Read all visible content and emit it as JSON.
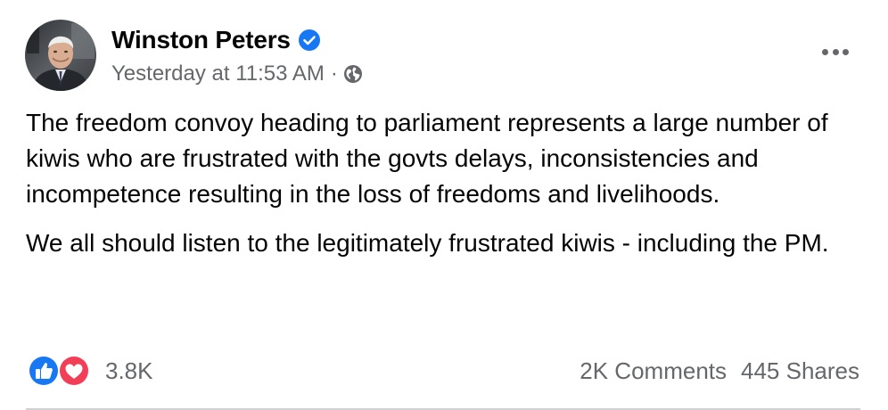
{
  "post": {
    "author": "Winston Peters",
    "timestamp": "Yesterday at 11:53 AM",
    "separator": "·",
    "privacy_icon": "globe-icon",
    "verified_icon": "verified-badge-icon",
    "more_icon": "more-options-icon",
    "paragraphs": [
      "The freedom convoy heading to parliament represents a large number of kiwis who are frustrated with the govts delays, inconsistencies and incompetence resulting in the loss of freedoms and livelihoods.",
      "We all should listen to the legitimately frustrated kiwis - including the PM."
    ]
  },
  "engagement": {
    "reaction_icons": [
      "like-reaction-icon",
      "love-reaction-icon"
    ],
    "reaction_count": "3.8K",
    "comments": "2K Comments",
    "shares": "445 Shares"
  },
  "colors": {
    "text_primary": "#050505",
    "text_secondary": "#65676b",
    "verified_blue": "#1877f2",
    "like_blue": "#1877f2",
    "love_red": "#f33e58",
    "divider": "#ced0d4"
  }
}
